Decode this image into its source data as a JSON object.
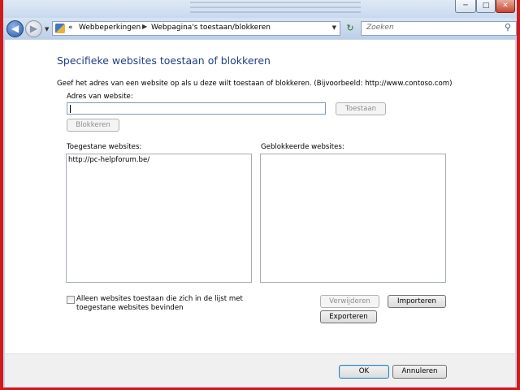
{
  "titlebar": {
    "minimize_glyph": "─",
    "maximize_glyph": "□",
    "close_glyph": "✕"
  },
  "nav": {
    "back_glyph": "◀",
    "forward_glyph": "▶",
    "history_dropdown_glyph": "▼",
    "breadcrumb_overflow": "«",
    "breadcrumb_separator": "▶",
    "breadcrumbs": [
      "Webbeperkingen",
      "Webpagina's toestaan/blokkeren"
    ],
    "address_dropdown_glyph": "▼",
    "refresh_glyph": "↻",
    "search_placeholder": "Zoeken",
    "search_icon_glyph": "⚲"
  },
  "page": {
    "heading": "Specifieke websites toestaan of blokkeren",
    "instruction": "Geef het adres van een website op als u deze wilt toestaan of blokkeren. (Bijvoorbeeld: http://www.contoso.com)",
    "address_label": "Adres van website:",
    "address_value": "",
    "allow_button": "Toestaan",
    "block_button": "Blokkeren",
    "allowed_label": "Toegestane websites:",
    "allowed_sites": [
      "http://pc-helpforum.be/"
    ],
    "blocked_label": "Geblokkeerde websites:",
    "blocked_sites": [],
    "only_allowed_checkbox": "Alleen websites toestaan die zich in de lijst met toegestane websites bevinden",
    "only_allowed_checked": false,
    "remove_button": "Verwijderen",
    "import_button": "Importeren",
    "export_button": "Exporteren"
  },
  "footer": {
    "ok_button": "OK",
    "cancel_button": "Annuleren"
  },
  "colors": {
    "heading": "#1e3f8a",
    "frame_red": "#d11a1a",
    "chrome_blue": "#c4d5ea"
  }
}
